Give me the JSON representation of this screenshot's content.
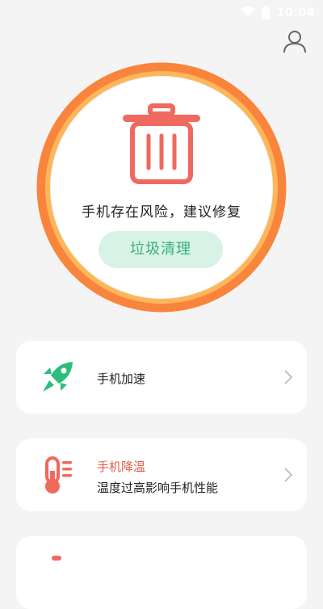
{
  "status_bar": {
    "time": "10:04",
    "icons": [
      "wifi-icon",
      "battery-icon"
    ]
  },
  "header": {
    "icon": "user-icon"
  },
  "hero": {
    "icon": "trash-icon",
    "message": "手机存在风险，建议修复",
    "button_label": "垃圾清理"
  },
  "cards": [
    {
      "icon": "rocket-icon",
      "title": "手机加速",
      "subtitle": ""
    },
    {
      "icon": "thermometer-icon",
      "title": "手机降温",
      "subtitle": "温度过高影响手机性能"
    },
    {
      "icon": "item-icon",
      "title": "",
      "subtitle": ""
    }
  ],
  "colors": {
    "ring_outer": "#f9843c",
    "ring_inner": "#fdb65a",
    "trash": "#ef6a5e",
    "accent_green": "#35b27a",
    "button_bg": "#d9f2e6",
    "warning_title": "#e0604f"
  }
}
